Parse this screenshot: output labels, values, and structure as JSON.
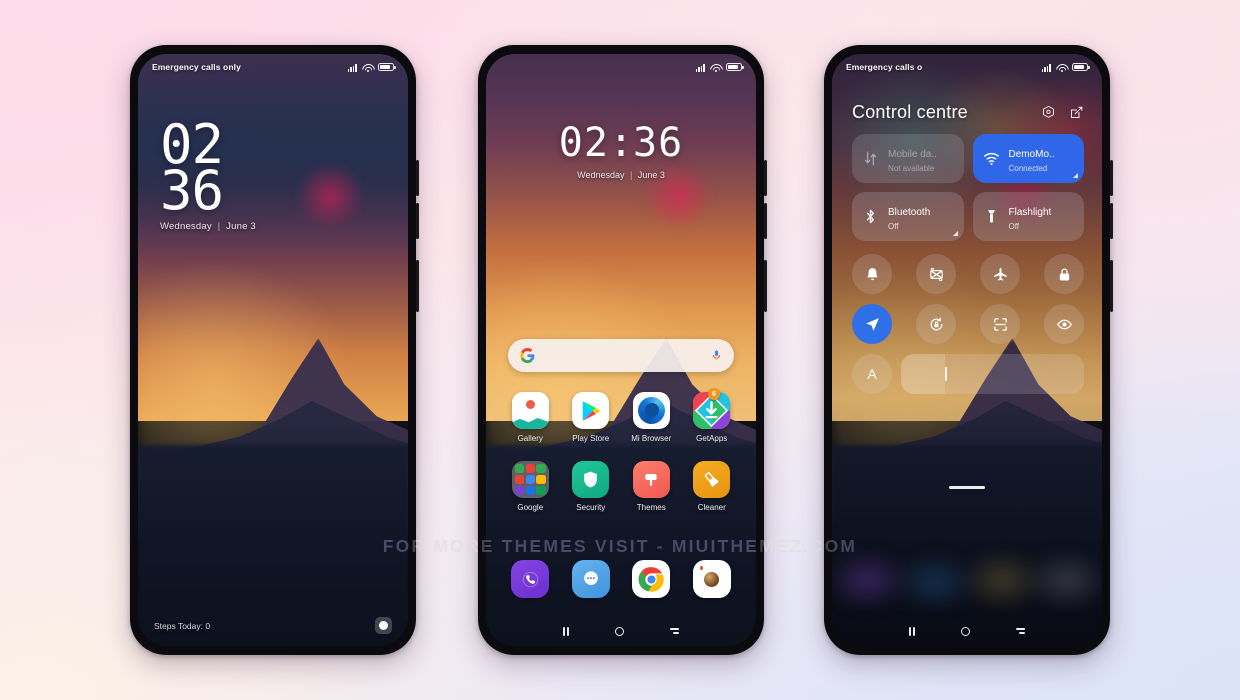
{
  "watermark": "FOR MORE THEMES VISIT - MIUITHEMEZ.COM",
  "lockscreen": {
    "status": {
      "carrier": "Emergency calls only",
      "signal_icon": "signal-bars-icon",
      "wifi_icon": "wifi-icon",
      "battery_icon": "battery-icon"
    },
    "clock_hours": "02",
    "clock_minutes": "36",
    "date_day": "Wednesday",
    "date_separator": "|",
    "date_date": "June 3",
    "steps": "Steps Today: 0",
    "camera_icon": "camera-shortcut-icon"
  },
  "homescreen": {
    "status": {
      "carrier": "",
      "signal_icon": "signal-bars-icon",
      "wifi_icon": "wifi-icon",
      "battery_icon": "battery-icon"
    },
    "clock_time": "02:36",
    "clock_hours": "02",
    "clock_minutes": "36",
    "date_day": "Wednesday",
    "date_separator": "|",
    "date_date": "June 3",
    "search": {
      "placeholder": "",
      "value": "",
      "logo_icon": "google-logo-icon",
      "mic_icon": "microphone-icon"
    },
    "apps_row1": [
      {
        "label": "Gallery",
        "icon": "gallery-icon",
        "badge": ""
      },
      {
        "label": "Play Store",
        "icon": "play-store-icon",
        "badge": ""
      },
      {
        "label": "Mi Browser",
        "icon": "mi-browser-icon",
        "badge": ""
      },
      {
        "label": "GetApps",
        "icon": "getapps-icon",
        "badge": "6"
      }
    ],
    "apps_row2": [
      {
        "label": "Google",
        "icon": "google-folder-icon",
        "badge": ""
      },
      {
        "label": "Security",
        "icon": "security-icon",
        "badge": ""
      },
      {
        "label": "Themes",
        "icon": "themes-icon",
        "badge": ""
      },
      {
        "label": "Cleaner",
        "icon": "cleaner-icon",
        "badge": ""
      }
    ],
    "dock": [
      {
        "label": "",
        "icon": "phone-icon"
      },
      {
        "label": "",
        "icon": "messages-icon"
      },
      {
        "label": "",
        "icon": "chrome-icon"
      },
      {
        "label": "",
        "icon": "camera-icon"
      }
    ],
    "nav": {
      "recents_icon": "recents-icon",
      "home_icon": "home-icon",
      "back_icon": "back-icon"
    }
  },
  "controlcentre": {
    "status": {
      "carrier": "Emergency calls o",
      "signal_icon": "signal-bars-icon",
      "wifi_icon": "wifi-icon",
      "battery_icon": "battery-icon"
    },
    "title": "Control centre",
    "actions": [
      {
        "icon": "settings-hex-icon"
      },
      {
        "icon": "edit-pencil-icon"
      }
    ],
    "tiles": [
      {
        "name": "Mobile da..",
        "sub": "Not available",
        "icon": "mobile-data-icon",
        "state": "dim",
        "expand": false
      },
      {
        "name": "DemoMo..",
        "sub": "Connected",
        "icon": "wifi-tile-icon",
        "state": "on",
        "expand": true
      },
      {
        "name": "Bluetooth",
        "sub": "Off",
        "icon": "bluetooth-icon",
        "state": "off",
        "expand": true
      },
      {
        "name": "Flashlight",
        "sub": "Off",
        "icon": "flashlight-icon",
        "state": "off",
        "expand": false
      }
    ],
    "toggles_row1": [
      {
        "icon": "bell-icon",
        "active": false
      },
      {
        "icon": "screenshot-icon",
        "active": false
      },
      {
        "icon": "airplane-icon",
        "active": false
      },
      {
        "icon": "lock-icon",
        "active": false
      }
    ],
    "toggles_row2": [
      {
        "icon": "location-icon",
        "active": true
      },
      {
        "icon": "auto-rotate-lock-icon",
        "active": false
      },
      {
        "icon": "scanner-icon",
        "active": false
      },
      {
        "icon": "eye-reading-mode-icon",
        "active": false
      }
    ],
    "brightness": {
      "auto_icon": "auto-brightness-icon",
      "auto_label": "A",
      "value_percent": 24
    },
    "handle_icon": "drag-handle-icon",
    "nav": {
      "recents_icon": "recents-icon",
      "home_icon": "home-icon",
      "back_icon": "back-icon"
    }
  },
  "colors": {
    "accent_blue": "#2f67e8",
    "badge_orange": "#f7941e",
    "tile_on": "#2f67e8"
  }
}
